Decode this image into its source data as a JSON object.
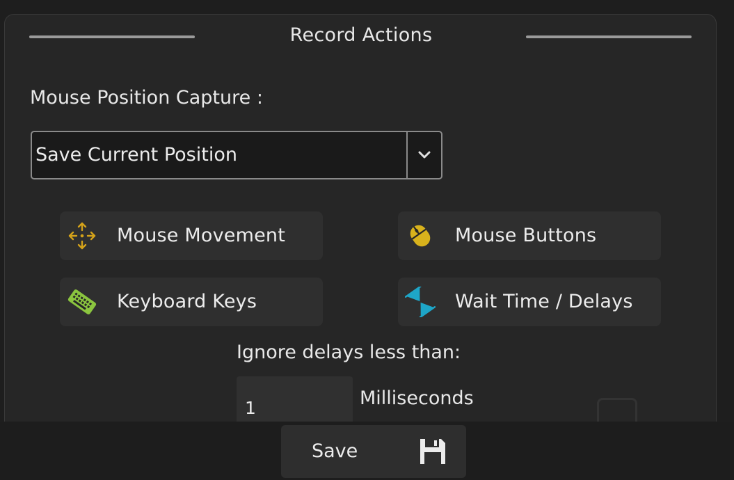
{
  "dialog": {
    "title": "Record Actions",
    "mouse_capture_label": "Mouse Position Capture :",
    "mouse_capture_select": {
      "value": "Save Current Position"
    },
    "options": [
      {
        "label": "Mouse Movement",
        "icon": "move-arrows-icon",
        "icon_color": "#d4a21a"
      },
      {
        "label": "Mouse Buttons",
        "icon": "mouse-icon",
        "icon_color": "#d8b21c"
      },
      {
        "label": "Keyboard Keys",
        "icon": "keyboard-icon",
        "icon_color": "#8bc53f"
      },
      {
        "label": "Wait Time / Delays",
        "icon": "hourglass-icon",
        "icon_color": "#1ea6c8"
      }
    ],
    "ignore_delays_label": "Ignore delays less than:",
    "ignore_delays_value": "1",
    "ignore_delays_unit": "Milliseconds"
  },
  "footer": {
    "save_label": "Save",
    "save_icon": "floppy-disk-icon"
  },
  "colors": {
    "panel_bg": "#262626",
    "button_bg": "#2f2f2f",
    "text": "#e8e8e8"
  }
}
